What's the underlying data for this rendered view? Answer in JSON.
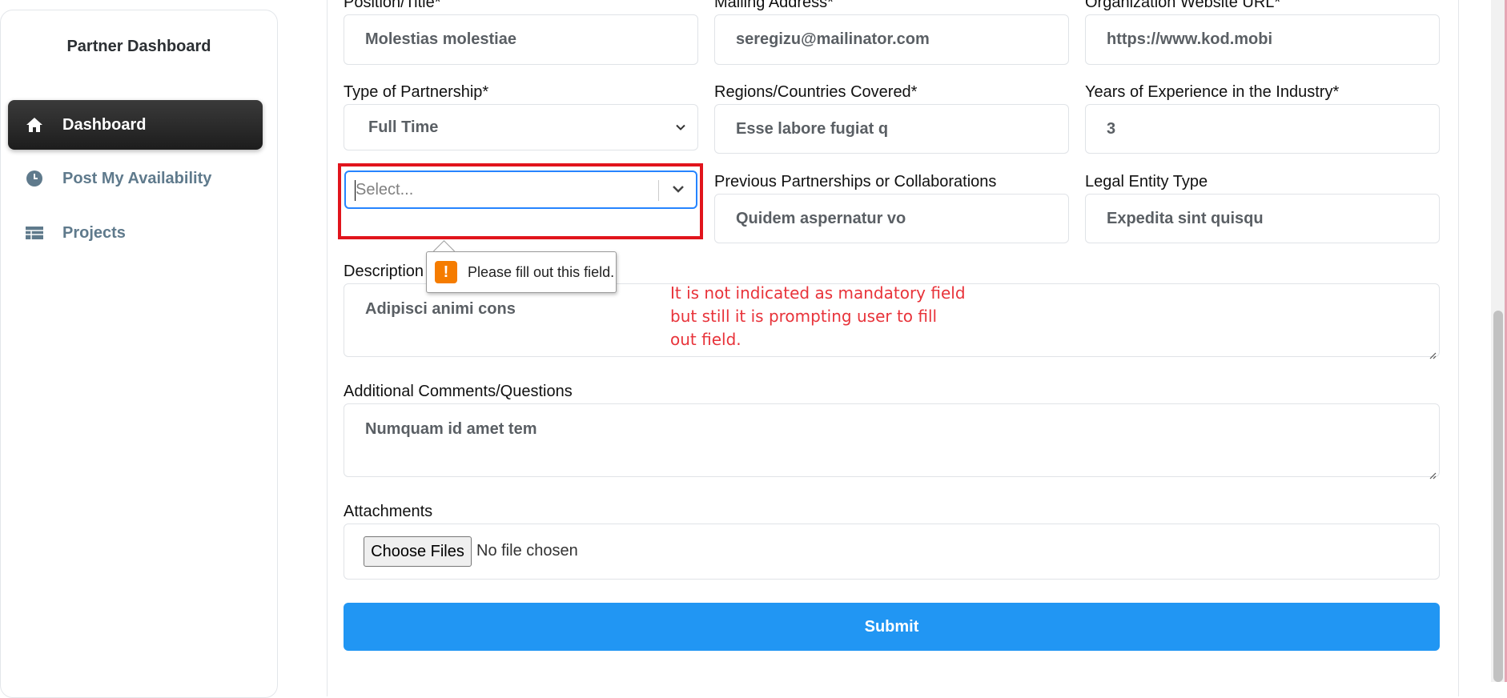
{
  "sidebar": {
    "brand": "Partner Dashboard",
    "items": [
      {
        "label": "Dashboard",
        "icon": "home-icon",
        "active": true
      },
      {
        "label": "Post My Availability",
        "icon": "clock-icon",
        "active": false
      },
      {
        "label": "Projects",
        "icon": "table-icon",
        "active": false
      }
    ]
  },
  "form": {
    "position_title": {
      "label": "Position/Title*",
      "value": "Molestias molestiae"
    },
    "mailing_address": {
      "label": "Mailing Address*",
      "value": "seregizu@mailinator.com"
    },
    "website": {
      "label": "Organization Website URL*",
      "value": "https://www.kod.mobi"
    },
    "partnership_type": {
      "label": "Type of Partnership*",
      "value": "Full Time"
    },
    "regions": {
      "label": "Regions/Countries Covered*",
      "value": "Esse labore fugiat q"
    },
    "experience": {
      "label": "Years of Experience in the Industry*",
      "value": "3"
    },
    "select": {
      "placeholder": "Select..."
    },
    "previous_partnerships": {
      "label": "Previous Partnerships or Collaborations",
      "value": "Quidem aspernatur vo"
    },
    "legal_entity": {
      "label": "Legal Entity Type",
      "value": "Expedita sint quisqu"
    },
    "description": {
      "label": "Description",
      "value": "Adipisci animi cons"
    },
    "comments": {
      "label": "Additional Comments/Questions",
      "value": "Numquam id amet tem"
    },
    "attachments": {
      "label": "Attachments",
      "button": "Choose Files",
      "status": "No file chosen"
    },
    "submit": "Submit"
  },
  "tooltip": {
    "text": "Please fill out this field."
  },
  "annotation": {
    "line1": "It is not indicated as mandatory field",
    "line2": "but still it is prompting user to fill",
    "line3": "out field."
  },
  "colors": {
    "accent": "#2196f3",
    "highlight": "#e1141c",
    "warning": "#f57c00"
  }
}
